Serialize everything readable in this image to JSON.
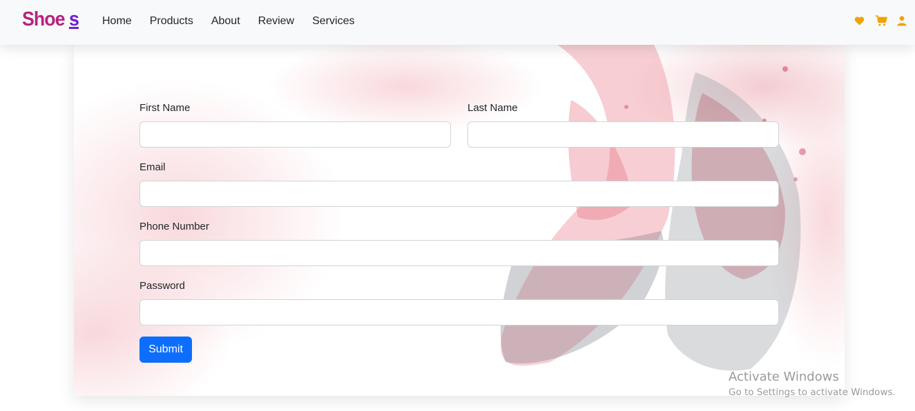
{
  "brand": {
    "text": "Shoe",
    "accent": "s"
  },
  "nav": {
    "links": [
      "Home",
      "Products",
      "About",
      "Review",
      "Services"
    ],
    "icons": [
      "heart-icon",
      "cart-icon",
      "user-icon"
    ],
    "icon_color": "#f5a000"
  },
  "form": {
    "first_name_label": "First Name",
    "last_name_label": "Last Name",
    "email_label": "Email",
    "phone_label": "Phone Number",
    "password_label": "Password",
    "first_name_value": "",
    "last_name_value": "",
    "email_value": "",
    "phone_value": "",
    "password_value": "",
    "submit_label": "Submit",
    "submit_color": "#0d6efd"
  },
  "watermark": {
    "title": "Activate Windows",
    "subtitle": "Go to Settings to activate Windows."
  }
}
